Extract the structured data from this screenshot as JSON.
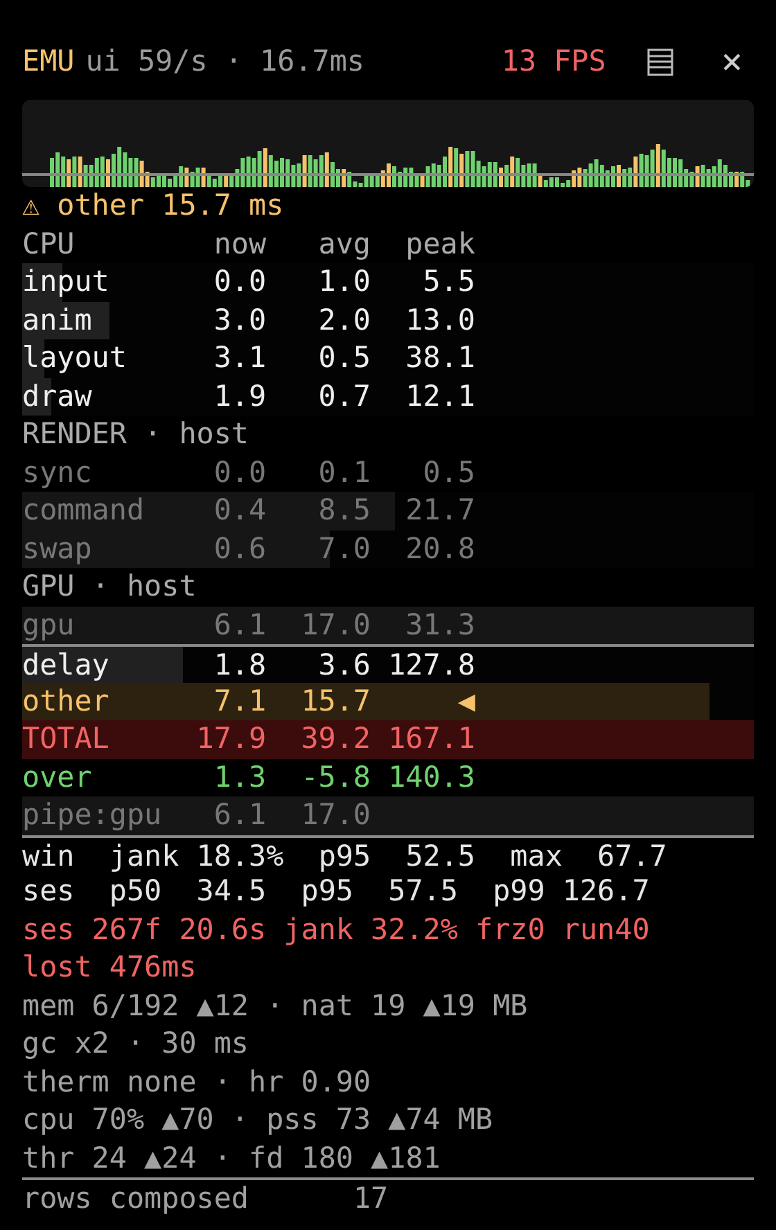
{
  "header": {
    "app": "EMU",
    "rate": "ui 59/s · 16.7ms",
    "fps": "13 FPS",
    "close": "×"
  },
  "warning": {
    "icon": "⚠",
    "text": "other 15.7 ms"
  },
  "sections": [
    {
      "title": "CPU",
      "columns": [
        "now",
        "avg",
        "peak"
      ],
      "rows": [
        {
          "name": "input",
          "now": "0.0",
          "avg": "1.0",
          "peak": "5.5",
          "kind": "normal",
          "level": 0.055
        },
        {
          "name": "anim",
          "now": "3.0",
          "avg": "2.0",
          "peak": "13.0",
          "kind": "normal",
          "level": 0.12
        },
        {
          "name": "layout",
          "now": "3.1",
          "avg": "0.5",
          "peak": "38.1",
          "kind": "normal",
          "level": 0.03
        },
        {
          "name": "draw",
          "now": "1.9",
          "avg": "0.7",
          "peak": "12.1",
          "kind": "normal",
          "level": 0.04
        }
      ]
    },
    {
      "title": "RENDER · host",
      "rows": [
        {
          "name": "sync",
          "now": "0.0",
          "avg": "0.1",
          "peak": "0.5",
          "kind": "dim"
        },
        {
          "name": "command",
          "now": "0.4",
          "avg": "8.5",
          "peak": "21.7",
          "kind": "dim",
          "level": 0.51
        },
        {
          "name": "swap",
          "now": "0.6",
          "avg": "7.0",
          "peak": "20.8",
          "kind": "dim",
          "level": 0.42
        }
      ]
    },
    {
      "title": "GPU · host",
      "rows": [
        {
          "name": "gpu",
          "now": "6.1",
          "avg": "17.0",
          "peak": "31.3",
          "kind": "dim",
          "highlighted": true
        }
      ]
    }
  ],
  "summary": [
    {
      "name": "delay",
      "now": "1.8",
      "avg": "3.6",
      "peak": "127.8",
      "kind": "normal",
      "level": 0.22
    },
    {
      "name": "other",
      "now": "7.1",
      "avg": "15.7",
      "peak": "◀",
      "kind": "warn",
      "level": 0.94
    },
    {
      "name": "TOTAL",
      "now": "17.9",
      "avg": "39.2",
      "peak": "167.1",
      "kind": "total",
      "highlighted": true
    },
    {
      "name": "over",
      "now": "1.3",
      "avg": "-5.8",
      "peak": "140.3",
      "kind": "good"
    },
    {
      "name": "pipe:gpu",
      "now": "6.1",
      "avg": "17.0",
      "kind": "dim",
      "highlighted": true
    }
  ],
  "stats": [
    {
      "text": "win  jank 18.3%  p95  52.5  max  67.7",
      "kind": "bright"
    },
    {
      "text": "ses  p50  34.5  p95  57.5  p99 126.7",
      "kind": "bright"
    },
    {
      "text": "ses 267f 20.6s jank 32.2% frz0 run40",
      "kind": "alert"
    },
    {
      "text": "lost 476ms",
      "kind": "alert"
    },
    {
      "text": "mem 6/192 ▲12 · nat 19 ▲19 MB",
      "kind": "muted"
    },
    {
      "text": "gc x2 · 30 ms",
      "kind": "muted"
    },
    {
      "text": "therm none · hr 0.90",
      "kind": "muted"
    },
    {
      "text": "cpu 70% ▲70 · pss 73 ▲74 MB",
      "kind": "muted"
    },
    {
      "text": "thr 24 ▲24 · fd 180 ▲181",
      "kind": "muted"
    }
  ],
  "footer": {
    "label": "rows composed",
    "value": "17"
  }
}
